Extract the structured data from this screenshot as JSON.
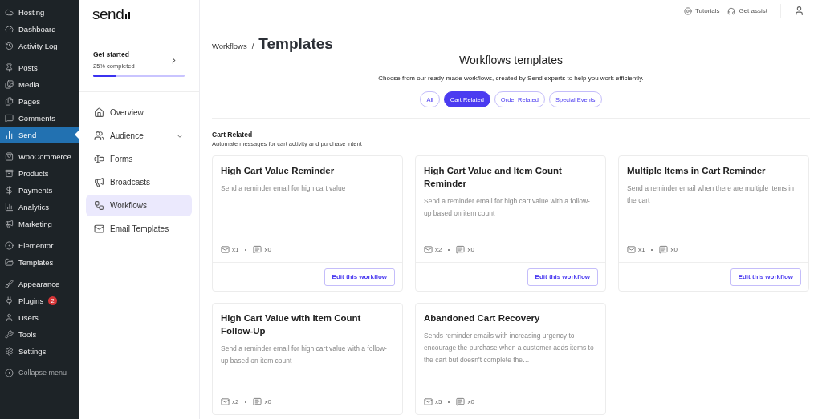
{
  "wp_menu": {
    "groups": [
      [
        {
          "label": "Hosting",
          "selected": false
        },
        {
          "label": "Dashboard",
          "selected": false
        },
        {
          "label": "Activity Log",
          "selected": false
        }
      ],
      [
        {
          "label": "Posts",
          "selected": false
        },
        {
          "label": "Media",
          "selected": false
        },
        {
          "label": "Pages",
          "selected": false
        },
        {
          "label": "Comments",
          "selected": false
        },
        {
          "label": "Send",
          "selected": true
        }
      ],
      [
        {
          "label": "WooCommerce",
          "selected": false
        },
        {
          "label": "Products",
          "selected": false
        },
        {
          "label": "Payments",
          "selected": false
        },
        {
          "label": "Analytics",
          "selected": false
        },
        {
          "label": "Marketing",
          "selected": false
        }
      ],
      [
        {
          "label": "Elementor",
          "selected": false
        },
        {
          "label": "Templates",
          "selected": false
        }
      ],
      [
        {
          "label": "Appearance",
          "selected": false
        },
        {
          "label": "Plugins",
          "selected": false,
          "badge": "2"
        },
        {
          "label": "Users",
          "selected": false
        },
        {
          "label": "Tools",
          "selected": false
        },
        {
          "label": "Settings",
          "selected": false
        }
      ]
    ],
    "collapse": "Collapse menu"
  },
  "app_sidebar": {
    "logo": "send",
    "progress": {
      "title": "Get started",
      "caption": "25% completed",
      "level": 0.25
    },
    "items": [
      {
        "label": "Overview",
        "selected": false
      },
      {
        "label": "Audience",
        "selected": false,
        "expandable": true
      },
      {
        "label": "Forms",
        "selected": false
      },
      {
        "label": "Broadcasts",
        "selected": false
      },
      {
        "label": "Workflows",
        "selected": true
      },
      {
        "label": "Email Templates",
        "selected": false
      }
    ]
  },
  "top_bar": {
    "links": [
      {
        "label": "Tutorials"
      },
      {
        "label": "Get assist"
      }
    ]
  },
  "breadcrumb": {
    "parent": "Workflows",
    "separator": "/",
    "current": "Templates"
  },
  "heading": "Workflows templates",
  "description": "Choose from our ready-made workflows, created by Send experts to help you work efficiently.",
  "filters": [
    {
      "label": "All",
      "selected": false
    },
    {
      "label": "Cart Related",
      "selected": true
    },
    {
      "label": "Order Related",
      "selected": false
    },
    {
      "label": "Special Events",
      "selected": false
    }
  ],
  "section": {
    "title": "Cart Related",
    "subtitle": "Automate messages for cart activity and purchase intent"
  },
  "cards": [
    {
      "title": "High Cart Value Reminder",
      "description": "Send a reminder email for high cart value",
      "emails": "x1",
      "messages": "x0",
      "button": "Edit this workflow"
    },
    {
      "title": "High Cart Value and Item Count Reminder",
      "description": "Send a reminder email for high cart value with a follow-up based on item count",
      "emails": "x2",
      "messages": "x0",
      "button": "Edit this workflow"
    },
    {
      "title": "Multiple Items in Cart Reminder",
      "description": "Send a reminder email when there are multiple items in the cart",
      "emails": "x1",
      "messages": "x0",
      "button": "Edit this workflow"
    },
    {
      "title": "High Cart Value with Item Count Follow-Up",
      "description": "Send a reminder email for high cart value with a follow-up based on item count",
      "emails": "x2",
      "messages": "x0"
    },
    {
      "title": "Abandoned Cart Recovery",
      "description": "Sends reminder emails with increasing urgency to encourage the purchase when a customer adds items to the cart but doesn't complete the…",
      "emails": "x5",
      "messages": "x0"
    }
  ]
}
